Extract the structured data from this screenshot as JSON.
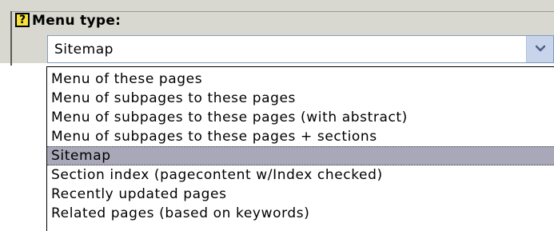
{
  "field": {
    "help_icon": "?",
    "label": "Menu type:"
  },
  "select": {
    "value": "Sitemap",
    "button_icon": "chevron-down-icon",
    "button_color": "#c8d4ec"
  },
  "options": [
    "Menu of these pages",
    "Menu of subpages to these pages",
    "Menu of subpages to these pages (with abstract)",
    "Menu of subpages to these pages + sections",
    "Sitemap",
    "Section index (pagecontent w/Index checked)",
    "Recently updated pages",
    "Related pages (based on keywords)"
  ],
  "selected_index": 4,
  "colors": {
    "header_background": "#d8d8d0",
    "selected_option": "#a8a8b8",
    "help_icon": "#f7e23a"
  }
}
